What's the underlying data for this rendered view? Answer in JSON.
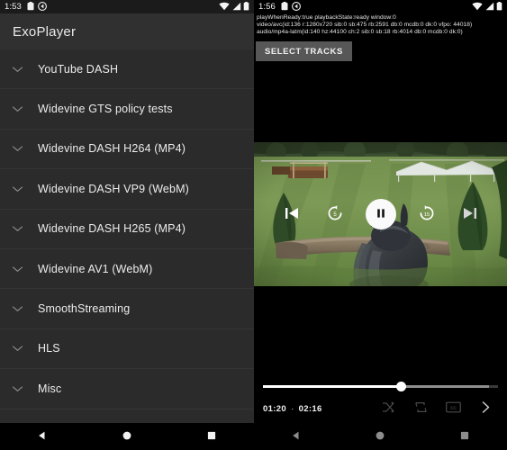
{
  "left": {
    "statusbar": {
      "time": "1:53",
      "icons": [
        "clipboard-icon",
        "cast-icon",
        "wifi-icon",
        "signal-icon",
        "battery-icon"
      ]
    },
    "appbar": {
      "title": "ExoPlayer"
    },
    "list": {
      "items": [
        {
          "label": "YouTube DASH",
          "expander": "chevron-down-icon"
        },
        {
          "label": "Widevine GTS policy tests",
          "expander": "chevron-down-icon"
        },
        {
          "label": "Widevine DASH H264 (MP4)",
          "expander": "chevron-down-icon"
        },
        {
          "label": "Widevine DASH VP9 (WebM)",
          "expander": "chevron-down-icon"
        },
        {
          "label": "Widevine DASH H265 (MP4)",
          "expander": "chevron-down-icon"
        },
        {
          "label": "Widevine AV1 (WebM)",
          "expander": "chevron-down-icon"
        },
        {
          "label": "SmoothStreaming",
          "expander": "chevron-down-icon"
        },
        {
          "label": "HLS",
          "expander": "chevron-down-icon"
        },
        {
          "label": "Misc",
          "expander": "chevron-down-icon"
        },
        {
          "label": "",
          "expander": "chevron-down-icon"
        }
      ]
    },
    "navbar": {
      "back": "back-triangle-icon",
      "home": "home-circle-icon",
      "recents": "recents-square-icon"
    }
  },
  "right": {
    "statusbar": {
      "time": "1:56",
      "icons": [
        "clipboard-icon",
        "cast-icon",
        "wifi-icon",
        "signal-icon",
        "battery-icon"
      ]
    },
    "debug": {
      "line1": "playWhenReady:true playbackState:ready window:0",
      "line2": "video/avc(id:136 r:1280x720 sib:0 sb:475 rb:2591 db:0 mcdb:0 dk:0 vfpo: 44018)",
      "line3": "audio/mp4a-latm(id:140 hz:44100 ch:2 sib:0 sb:18 rb:4014 db:0 mcdb:0 dk:0)"
    },
    "select_tracks_label": "SELECT TRACKS",
    "player": {
      "state": "playing",
      "position": "01:20",
      "duration": "02:16",
      "time_separator": "·",
      "progress_percent": 59,
      "buffered_percent": 96,
      "transport": [
        {
          "name": "previous-icon",
          "label": "Previous"
        },
        {
          "name": "rewind-5-icon",
          "label": "Rewind 5s"
        },
        {
          "name": "pause-icon",
          "label": "Pause"
        },
        {
          "name": "forward-15-icon",
          "label": "Forward 15s"
        },
        {
          "name": "next-icon",
          "label": "Next"
        }
      ],
      "bottom_controls": [
        {
          "name": "shuffle-icon",
          "label": "Shuffle"
        },
        {
          "name": "repeat-icon",
          "label": "Repeat"
        },
        {
          "name": "subtitles-cc-icon",
          "label": "Subtitles"
        },
        {
          "name": "more-chevron-right-icon",
          "label": "More"
        }
      ]
    },
    "navbar": {
      "back": "back-triangle-icon",
      "home": "home-circle-icon",
      "recents": "recents-square-icon"
    }
  },
  "colors": {
    "appbar": "#303030",
    "list_bg": "#2b2b2b",
    "divider": "#343434",
    "text": "#ededed",
    "accent_white": "#ffffff",
    "button_bg": "#575757",
    "statusbar_left": "#1b1b1b",
    "background": "#000000"
  }
}
